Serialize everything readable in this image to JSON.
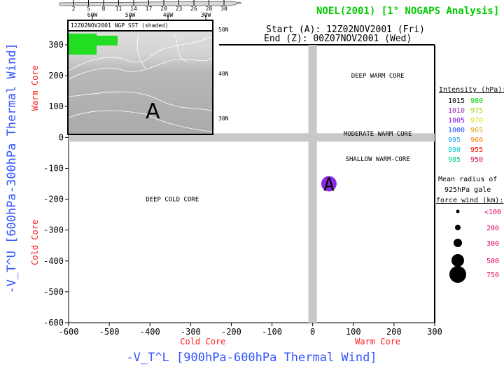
{
  "title": "NOEL(2001) [1° NOGAPS Analysis]",
  "start_label": "Start (A): 12Z02NOV2001 (Fri)",
  "end_label": "End (Z): 00Z07NOV2001 (Wed)",
  "colors": {
    "title": "#00cc00",
    "axis_label": "#3355ff",
    "core_label": "#ff2020",
    "point": "#8a2be2"
  },
  "inset": {
    "title": "12Z02NOV2001 NGP SST (shaded)",
    "colorbar_ticks": [
      "2",
      "5",
      "8",
      "11",
      "14",
      "17",
      "20",
      "23",
      "26",
      "28",
      "30"
    ],
    "lon_labels": [
      "60W",
      "50W",
      "40W",
      "30W"
    ],
    "lat_labels": [
      "50N",
      "40N",
      "30N"
    ],
    "contour_labels": [
      "8",
      "11",
      "11",
      "11",
      "14",
      "14",
      "17",
      "17",
      "17",
      "20",
      "20",
      "20",
      "23",
      "23",
      "23",
      "23",
      "26",
      "26",
      "26",
      "28",
      "1"
    ],
    "marker": "A"
  },
  "chart_data": {
    "type": "scatter",
    "xlabel": "-V_T^L [900hPa-600hPa Thermal Wind]",
    "ylabel": "-V_T^U [600hPa-300hPa Thermal Wind]",
    "xlim": [
      -600,
      300
    ],
    "ylim": [
      -600,
      350
    ],
    "xticks": [
      -600,
      -500,
      -400,
      -300,
      -200,
      -100,
      0,
      100,
      200,
      300
    ],
    "yticks": [
      -600,
      -500,
      -400,
      -300,
      -200,
      -100,
      0,
      100,
      200,
      300
    ],
    "x_cold_label": "Cold Core",
    "x_warm_label": "Warm Core",
    "y_cold_label": "Cold Core",
    "y_warm_label": "Warm Core",
    "regions": [
      "DEEP WARM CORE",
      "MODERATE WARM CORE",
      "SHALLOW WARM-CORE",
      "DEEP COLD CORE"
    ],
    "points": [
      {
        "x": 40,
        "y": -150,
        "label": "A",
        "pressure_hPa": 1005
      }
    ]
  },
  "legend": {
    "intensity_title": "Intensity (hPa):",
    "intensity": [
      {
        "v": "1015",
        "c": "#000000"
      },
      {
        "v": "980",
        "c": "#00cc00"
      },
      {
        "v": "1010",
        "c": "#a020c0"
      },
      {
        "v": "975",
        "c": "#99dd00"
      },
      {
        "v": "1005",
        "c": "#7a10e0"
      },
      {
        "v": "970",
        "c": "#dddd00"
      },
      {
        "v": "1000",
        "c": "#2050ff"
      },
      {
        "v": "965",
        "c": "#e0a000"
      },
      {
        "v": "995",
        "c": "#20a0ff"
      },
      {
        "v": "960",
        "c": "#ff8000"
      },
      {
        "v": "990",
        "c": "#00c8c8"
      },
      {
        "v": "955",
        "c": "#ff0000"
      },
      {
        "v": "985",
        "c": "#00c890"
      },
      {
        "v": "950",
        "c": "#e00060"
      }
    ],
    "radius_title_lines": [
      "Mean radius of",
      "925hPa gale",
      "force wind (km):"
    ],
    "radius": [
      "<100",
      "200",
      "300",
      "500",
      "750"
    ]
  }
}
